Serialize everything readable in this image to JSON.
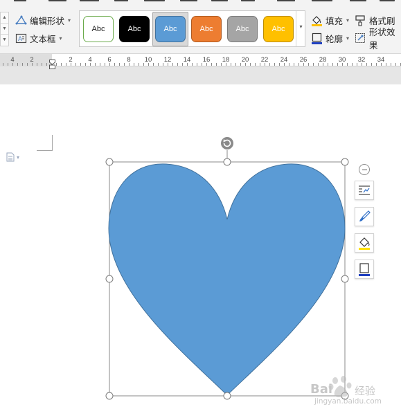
{
  "ribbon": {
    "edit_shape_label": "编辑形状",
    "text_box_label": "文本框",
    "fill_label": "填充",
    "outline_label": "轮廓",
    "format_painter_label": "格式刷",
    "shape_effects_label": "形状效果",
    "style_swatches": [
      {
        "label": "Abc",
        "fill": "#ffffff",
        "border": "#6aaa4a",
        "text": "#222222"
      },
      {
        "label": "Abc",
        "fill": "#000000",
        "border": "#000000",
        "text": "#ffffff"
      },
      {
        "label": "Abc",
        "fill": "#5b9bd5",
        "border": "#41719c",
        "text": "#ffffff",
        "selected": true
      },
      {
        "label": "Abc",
        "fill": "#ed7d31",
        "border": "#ae5a21",
        "text": "#ffffff"
      },
      {
        "label": "Abc",
        "fill": "#a5a5a5",
        "border": "#787878",
        "text": "#ffffff"
      },
      {
        "label": "Abc",
        "fill": "#ffc000",
        "border": "#bc8c00",
        "text": "#ffffff"
      }
    ]
  },
  "ruler": {
    "labels": [
      "4",
      "2",
      "2",
      "4",
      "6",
      "8",
      "10",
      "12",
      "14",
      "16",
      "18",
      "20",
      "22",
      "24",
      "26",
      "28",
      "30",
      "32",
      "34"
    ]
  },
  "shape": {
    "type": "heart",
    "fill": "#5b9bd5",
    "outline": "#41719c"
  },
  "float_toolbar": {
    "icons": [
      "text-wrap-icon",
      "brush-icon",
      "fill-bucket-icon",
      "outline-frame-icon"
    ]
  },
  "watermark": {
    "brand": "Bai",
    "brand_suffix": "经验",
    "url": "jingyan.baidu.com"
  }
}
